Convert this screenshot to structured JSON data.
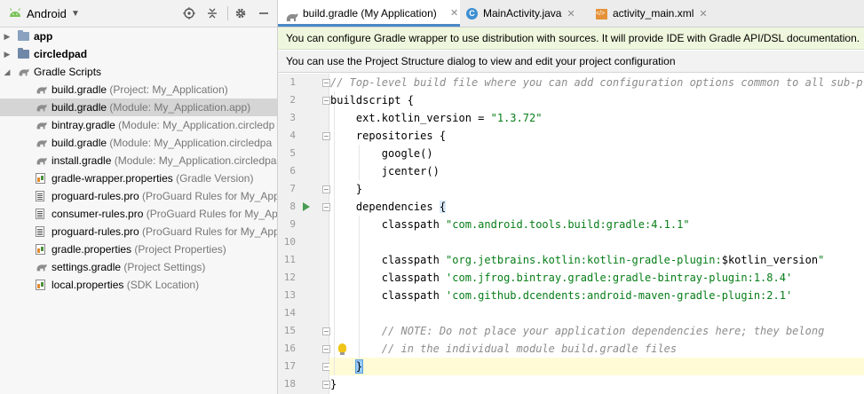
{
  "project_panel": {
    "view_label": "Android",
    "tree": [
      {
        "label": "app",
        "sub": "",
        "type": "folder",
        "bold": true,
        "arrow": "right",
        "level": 0
      },
      {
        "label": "circledpad",
        "sub": "",
        "type": "folder",
        "bold": true,
        "arrow": "right",
        "level": 0
      },
      {
        "label": "Gradle Scripts",
        "sub": "",
        "type": "gradle",
        "bold": false,
        "arrow": "down",
        "level": 0
      },
      {
        "label": "build.gradle",
        "sub": " (Project: My_Application)",
        "type": "gradle",
        "level": 1
      },
      {
        "label": "build.gradle",
        "sub": " (Module: My_Application.app)",
        "type": "gradle",
        "level": 1,
        "selected": true
      },
      {
        "label": "bintray.gradle",
        "sub": " (Module: My_Application.circledp",
        "type": "gradle",
        "level": 1
      },
      {
        "label": "build.gradle",
        "sub": " (Module: My_Application.circledpa",
        "type": "gradle",
        "level": 1
      },
      {
        "label": "install.gradle",
        "sub": " (Module: My_Application.circledpa",
        "type": "gradle",
        "level": 1
      },
      {
        "label": "gradle-wrapper.properties",
        "sub": " (Gradle Version)",
        "type": "prop",
        "level": 1
      },
      {
        "label": "proguard-rules.pro",
        "sub": " (ProGuard Rules for My_App",
        "type": "txt",
        "level": 1
      },
      {
        "label": "consumer-rules.pro",
        "sub": " (ProGuard Rules for My_App",
        "type": "txt",
        "level": 1
      },
      {
        "label": "proguard-rules.pro",
        "sub": " (ProGuard Rules for My_App",
        "type": "txt",
        "level": 1
      },
      {
        "label": "gradle.properties",
        "sub": " (Project Properties)",
        "type": "prop",
        "level": 1
      },
      {
        "label": "settings.gradle",
        "sub": " (Project Settings)",
        "type": "gradle",
        "level": 1
      },
      {
        "label": "local.properties",
        "sub": " (SDK Location)",
        "type": "prop",
        "level": 1
      }
    ]
  },
  "tabs": [
    {
      "label": "build.gradle (My Application)",
      "icon": "gradle-icon",
      "active": true
    },
    {
      "label": "MainActivity.java",
      "icon": "java-class-icon",
      "active": false
    },
    {
      "label": "activity_main.xml",
      "icon": "xml-file-icon",
      "active": false
    }
  ],
  "notifications": {
    "wrapper": "You can configure Gradle wrapper to use distribution with sources. It will provide IDE with Gradle API/DSL documentation.",
    "structure": "You can use the Project Structure dialog to view and edit your project configuration"
  },
  "code": {
    "line_numbers": [
      "1",
      "2",
      "3",
      "4",
      "5",
      "6",
      "7",
      "8",
      "9",
      "10",
      "11",
      "12",
      "13",
      "14",
      "15",
      "16",
      "17",
      "18"
    ],
    "lines": [
      [
        {
          "t": "// Top-level build file where you can add configuration options common to all sub-projects/modules.",
          "c": "cm"
        }
      ],
      [
        {
          "t": "buildscript {",
          "c": ""
        }
      ],
      [
        {
          "t": "    ext.kotlin_version = ",
          "c": ""
        },
        {
          "t": "\"1.3.72\"",
          "c": "st"
        }
      ],
      [
        {
          "t": "    repositories {",
          "c": ""
        }
      ],
      [
        {
          "t": "        google()",
          "c": ""
        }
      ],
      [
        {
          "t": "        jcenter()",
          "c": ""
        }
      ],
      [
        {
          "t": "    }",
          "c": ""
        }
      ],
      [
        {
          "t": "    dependencies ",
          "c": ""
        },
        {
          "t": "{",
          "c": "brace-match"
        }
      ],
      [
        {
          "t": "        classpath ",
          "c": ""
        },
        {
          "t": "\"com.android.tools.build:gradle:4.1.1\"",
          "c": "st"
        }
      ],
      [
        {
          "t": "",
          "c": ""
        }
      ],
      [
        {
          "t": "        classpath ",
          "c": ""
        },
        {
          "t": "\"org.jetbrains.kotlin:kotlin-gradle-plugin:",
          "c": "st"
        },
        {
          "t": "$kotlin_version",
          "c": ""
        },
        {
          "t": "\"",
          "c": "st"
        }
      ],
      [
        {
          "t": "        classpath ",
          "c": ""
        },
        {
          "t": "'com.jfrog.bintray.gradle:gradle-bintray-plugin:1.8.4'",
          "c": "st"
        }
      ],
      [
        {
          "t": "        classpath ",
          "c": ""
        },
        {
          "t": "'com.github.dcendents:android-maven-gradle-plugin:2.1'",
          "c": "st"
        }
      ],
      [
        {
          "t": "",
          "c": ""
        }
      ],
      [
        {
          "t": "        // NOTE: Do not place your application dependencies here; they belong",
          "c": "cm"
        }
      ],
      [
        {
          "t": "        // in the individual module build.gradle files",
          "c": "cm"
        }
      ],
      [
        {
          "t": "    ",
          "c": ""
        },
        {
          "t": "}",
          "c": "brace-hl"
        }
      ],
      [
        {
          "t": "}",
          "c": ""
        }
      ]
    ]
  }
}
